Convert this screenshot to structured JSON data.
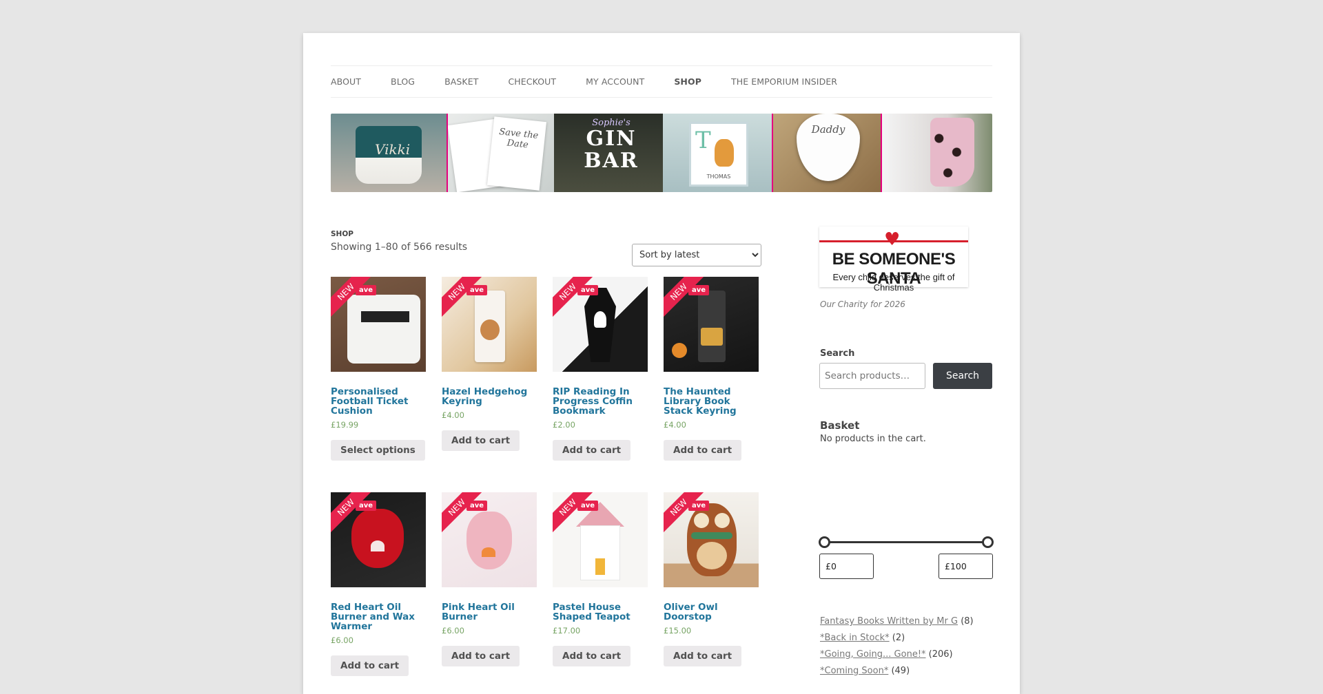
{
  "nav": {
    "items": [
      {
        "label": "ABOUT"
      },
      {
        "label": "BLOG"
      },
      {
        "label": "BASKET"
      },
      {
        "label": "CHECKOUT"
      },
      {
        "label": "MY ACCOUNT"
      },
      {
        "label": "SHOP"
      },
      {
        "label": "THE EMPORIUM INSIDER"
      }
    ],
    "active": "SHOP"
  },
  "banner": {
    "mug_name": "Vikki",
    "card_text": "Save the Date",
    "gin_line1": "Sophie's",
    "gin_line2": "GIN",
    "gin_line3": "BAR",
    "print_name": "THOMAS",
    "pick_text": "Daddy"
  },
  "shop": {
    "breadcrumb": "SHOP",
    "result_count": "Showing 1–80 of 566 results",
    "sort_selected": "Sort by latest",
    "badge_new": "NEW",
    "badge_save": "ave"
  },
  "products": [
    {
      "name": "Personalised Football Ticket Cushion",
      "price": "£19.99",
      "button": "Select options",
      "image": "cushion"
    },
    {
      "name": "Hazel Hedgehog Keyring",
      "price": "£4.00",
      "button": "Add to cart",
      "image": "keyring"
    },
    {
      "name": "RIP Reading In Progress Coffin Bookmark",
      "price": "£2.00",
      "button": "Add to cart",
      "image": "bookmark"
    },
    {
      "name": "The Haunted Library Book Stack Keyring",
      "price": "£4.00",
      "button": "Add to cart",
      "image": "book-keyring"
    },
    {
      "name": "Red Heart Oil Burner and Wax Warmer",
      "price": "£6.00",
      "button": "Add to cart",
      "image": "red-burner"
    },
    {
      "name": "Pink Heart Oil Burner",
      "price": "£6.00",
      "button": "Add to cart",
      "image": "pink-burner"
    },
    {
      "name": "Pastel House Shaped Teapot",
      "price": "£17.00",
      "button": "Add to cart",
      "image": "teapot"
    },
    {
      "name": "Oliver Owl Doorstop",
      "price": "£15.00",
      "button": "Add to cart",
      "image": "owl"
    }
  ],
  "sidebar": {
    "charity_big": "BE SOMEONE'S SANTA",
    "charity_small": "Every child deserves the gift of Christmas",
    "charity_caption": "Our Charity for 2026",
    "search_title": "Search",
    "search_placeholder": "Search products…",
    "search_button": "Search",
    "basket_title": "Basket",
    "basket_empty": "No products in the cart.",
    "price_min": "£0",
    "price_max": "£100",
    "categories": [
      {
        "name": "Fantasy Books Written by Mr G",
        "count": "(8)"
      },
      {
        "name": "*Back in Stock*",
        "count": "(2)"
      },
      {
        "name": "*Going, Going... Gone!*",
        "count": "(206)"
      },
      {
        "name": "*Coming Soon*",
        "count": "(49)"
      }
    ]
  },
  "colors": {
    "link": "#21759b",
    "price": "#77a464",
    "badge": "#e6234d",
    "banner_divider": "#e6007e"
  }
}
